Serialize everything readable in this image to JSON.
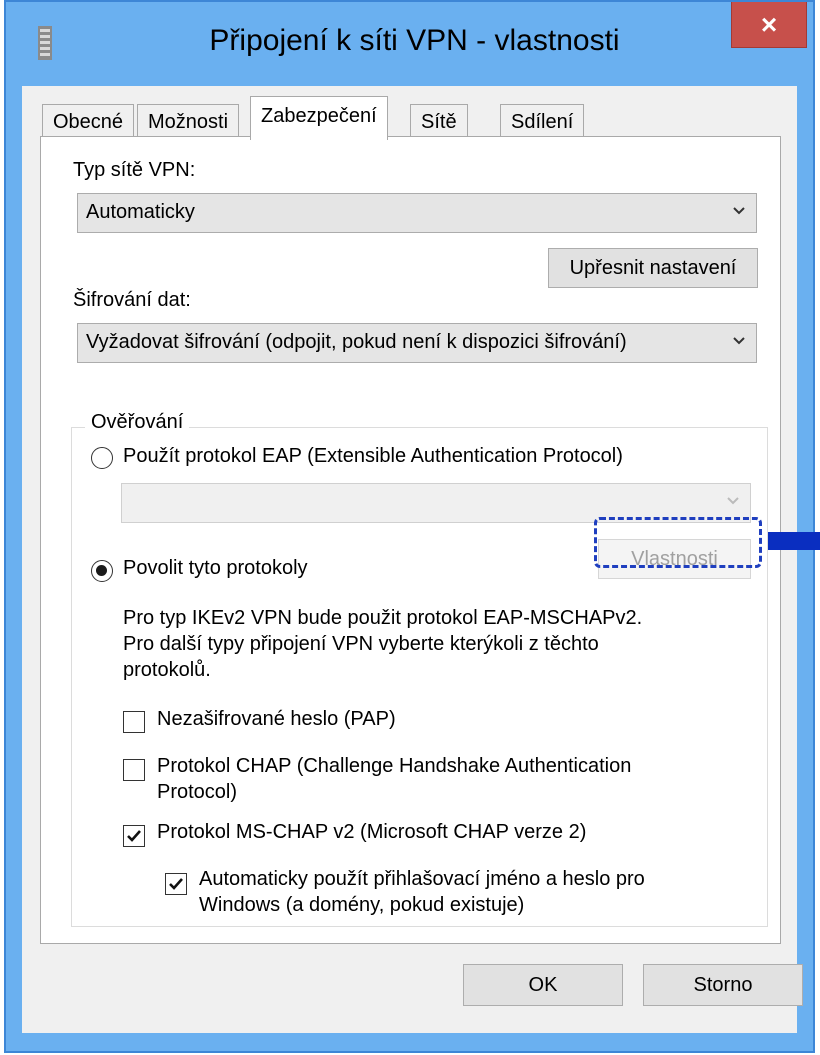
{
  "window": {
    "title": "Připojení k síti VPN - vlastnosti",
    "close_label": "×"
  },
  "tabs": [
    {
      "label": "Obecné"
    },
    {
      "label": "Možnosti"
    },
    {
      "label": "Zabezpečení"
    },
    {
      "label": "Sítě"
    },
    {
      "label": "Sdílení"
    }
  ],
  "security": {
    "vpn_type_label": "Typ sítě VPN:",
    "vpn_type_value": "Automaticky",
    "advanced_button": "Upřesnit nastavení",
    "encryption_label": "Šifrování dat:",
    "encryption_value": "Vyžadovat šifrování (odpojit, pokud není k dispozici šifrování)",
    "auth_group_label": "Ověřování",
    "eap_radio_label": "Použít protokol EAP (Extensible Authentication Protocol)",
    "eap_combo_value": "",
    "properties_button": "Vlastnosti",
    "allow_radio_label": "Povolit tyto protokoly",
    "info_line1": "Pro typ IKEv2 VPN bude použit protokol EAP-MSCHAPv2.",
    "info_line2": "Pro další typy připojení VPN vyberte kterýkoli z těchto",
    "info_line3": "protokolů.",
    "pap_label": "Nezašifrované heslo (PAP)",
    "chap_label_line1": "Protokol CHAP (Challenge Handshake Authentication",
    "chap_label_line2": "Protocol)",
    "mschap_label": "Protokol MS-CHAP v2 (Microsoft CHAP verze 2)",
    "auto_logon_line1": "Automaticky použít přihlašovací jméno a heslo pro",
    "auto_logon_line2": "Windows (a domény, pokud existuje)"
  },
  "footer": {
    "ok_button": "OK",
    "cancel_button": "Storno"
  },
  "colors": {
    "frame": "#6ab0f0",
    "close": "#c7504b",
    "highlight": "#1f3fbf"
  }
}
